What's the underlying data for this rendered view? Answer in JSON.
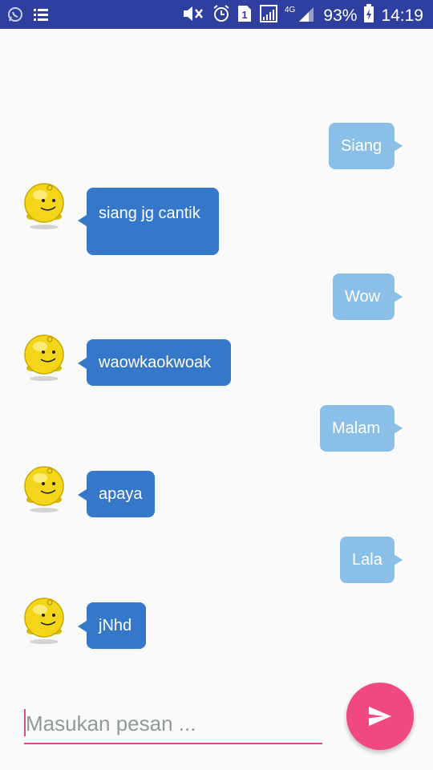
{
  "status_bar": {
    "battery": "93%",
    "time": "14:19",
    "network": "4G",
    "icons": [
      "whatsapp-icon",
      "list-icon",
      "mute-icon",
      "alarm-icon",
      "sim-icon",
      "signal-icon",
      "signal-4g-icon",
      "battery-charging-icon"
    ]
  },
  "conversation": {
    "messages": [
      {
        "sender": "me",
        "text": "Siang"
      },
      {
        "sender": "bot",
        "text": "siang jg cantik"
      },
      {
        "sender": "me",
        "text": "Wow"
      },
      {
        "sender": "bot",
        "text": "waowkaokwoak"
      },
      {
        "sender": "me",
        "text": "Malam"
      },
      {
        "sender": "bot",
        "text": "apaya"
      },
      {
        "sender": "me",
        "text": "Lala"
      },
      {
        "sender": "bot",
        "text": "jNhd"
      }
    ]
  },
  "composer": {
    "placeholder": "Masukan pesan ...",
    "value": "",
    "send_icon": "send-icon"
  },
  "colors": {
    "status_bar": "#2f3f9f",
    "bubble_me": "#8abfe8",
    "bubble_bot": "#3577c9",
    "accent": "#f0497f"
  }
}
